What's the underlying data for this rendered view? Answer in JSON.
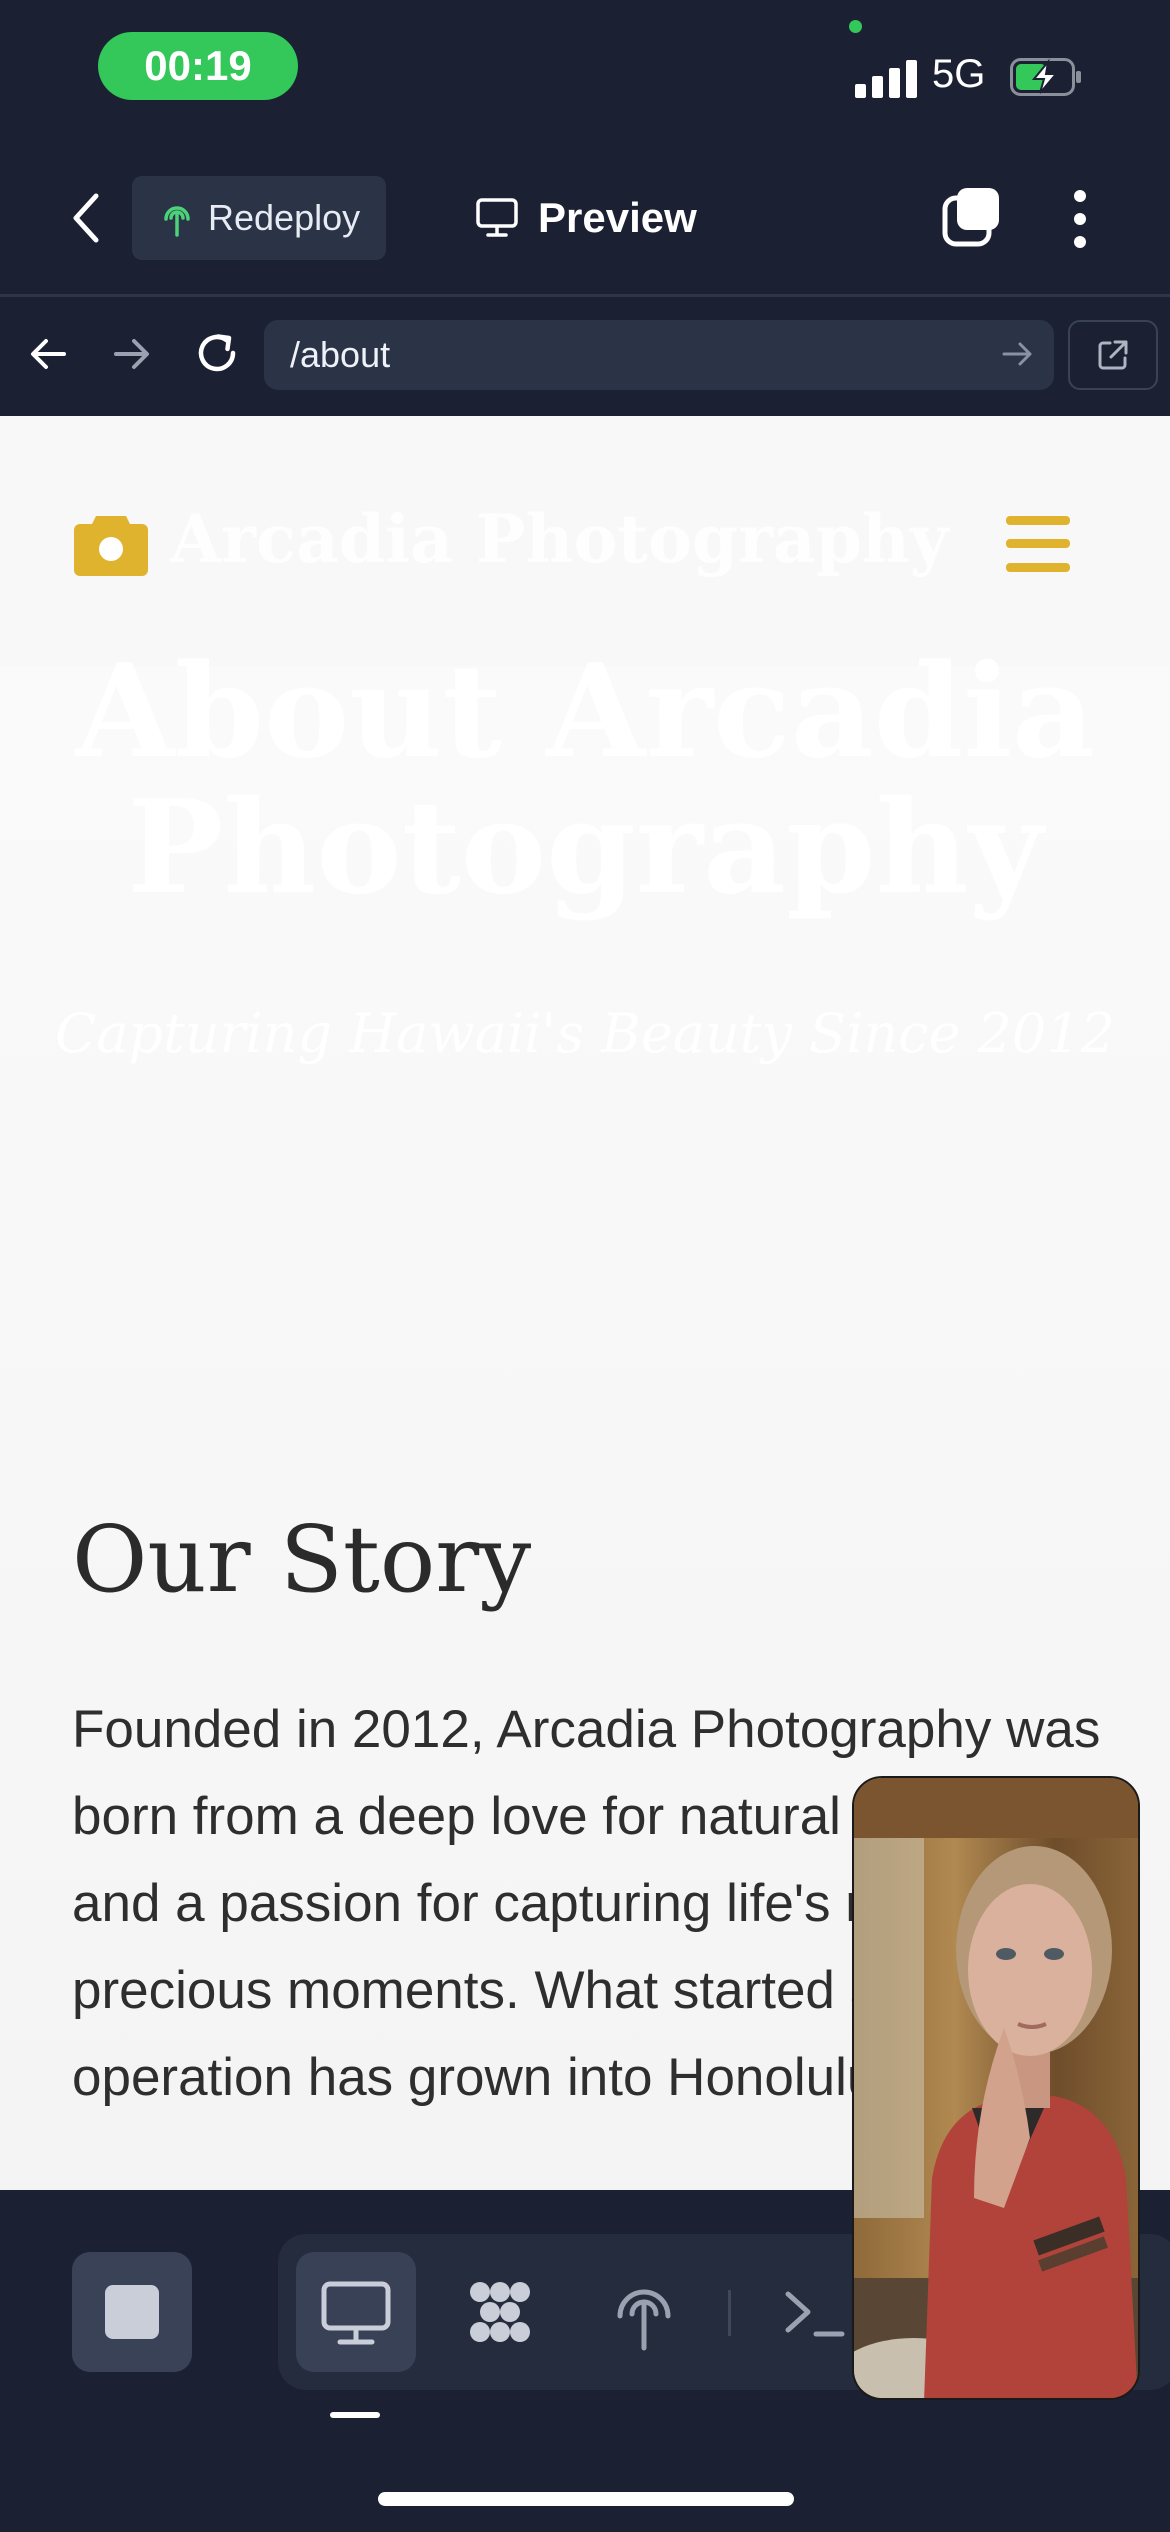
{
  "status_bar": {
    "time": "00:19",
    "network": "5G"
  },
  "toolbar": {
    "redeploy_label": "Redeploy",
    "preview_label": "Preview"
  },
  "url_bar": {
    "url": "/about"
  },
  "site": {
    "logo_text": "Arcadia Photography",
    "hero_title": "About Arcadia Photography",
    "hero_subtitle": "Capturing Hawaii's Beauty Since 2012",
    "story_heading": "Our Story",
    "story_text": "Founded in 2012, Arcadia Photography was born from a deep love for natural beauty and a passion for capturing life's most precious moments. What started as a small operation has grown into Honolulu's premier"
  },
  "colors": {
    "accent": "#e0b32e",
    "status_green": "#34c759",
    "app_bg": "#1b2132"
  },
  "bottom_bar": {
    "tools": [
      "preview-icon",
      "extensions-icon",
      "deploy-icon",
      "terminal-icon"
    ],
    "active_tool": "preview-icon"
  }
}
